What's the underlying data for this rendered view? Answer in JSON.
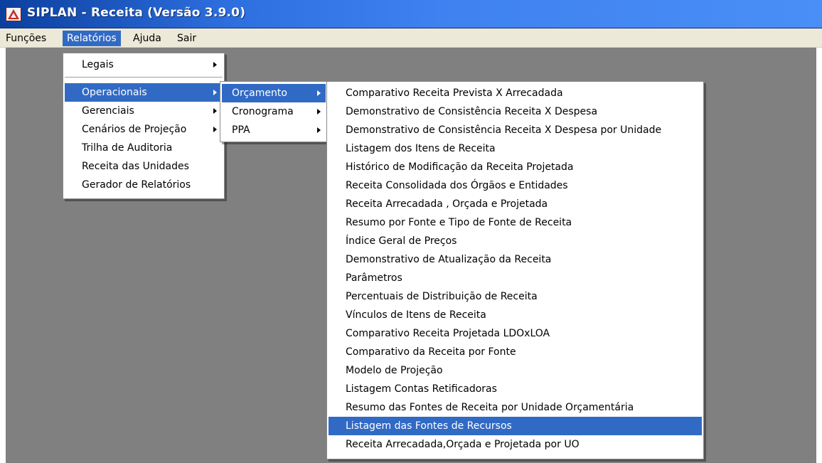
{
  "window": {
    "title": "SIPLAN - Receita (Versão 3.9.0)"
  },
  "menubar": {
    "items": [
      "Funções",
      "Relatórios",
      "Ajuda",
      "Sair"
    ],
    "active": "Relatórios"
  },
  "relatorios_menu": {
    "items": [
      "Legais",
      "Operacionais",
      "Gerenciais",
      "Cenários de Projeção",
      "Trilha de Auditoria",
      "Receita das Unidades",
      "Gerador de Relatórios"
    ],
    "selected": "Operacionais"
  },
  "operacionais_menu": {
    "items": [
      "Orçamento",
      "Cronograma",
      "PPA"
    ],
    "selected": "Orçamento"
  },
  "orcamento_menu": {
    "items": [
      "Comparativo Receita Prevista X Arrecadada",
      "Demonstrativo de Consistência Receita X Despesa",
      "Demonstrativo de Consistência Receita X Despesa por Unidade",
      "Listagem dos Itens de Receita",
      "Histórico de Modificação da Receita Projetada",
      "Receita Consolidada dos Órgãos e Entidades",
      "Receita Arrecadada , Orçada e Projetada",
      "Resumo por Fonte e Tipo de Fonte de Receita",
      "Índice Geral de Preços",
      "Demonstrativo de Atualização da Receita",
      "Parâmetros",
      "Percentuais de Distribuição de Receita",
      "Vínculos de Itens de Receita",
      "Comparativo Receita Projetada LDOxLOA",
      "Comparativo da Receita por Fonte",
      "Modelo de Projeção",
      "Listagem Contas Retificadoras",
      "Resumo das Fontes de Receita por Unidade Orçamentária",
      "Listagem das Fontes de Recursos",
      "Receita Arrecadada,Orçada e Projetada  por UO"
    ],
    "selected": "Listagem das Fontes de Recursos"
  },
  "colors": {
    "menu_highlight": "#316ac5",
    "menubar_bg": "#ece9d8",
    "desktop_bg": "#808080",
    "titlebar": "#2e6fe0"
  }
}
